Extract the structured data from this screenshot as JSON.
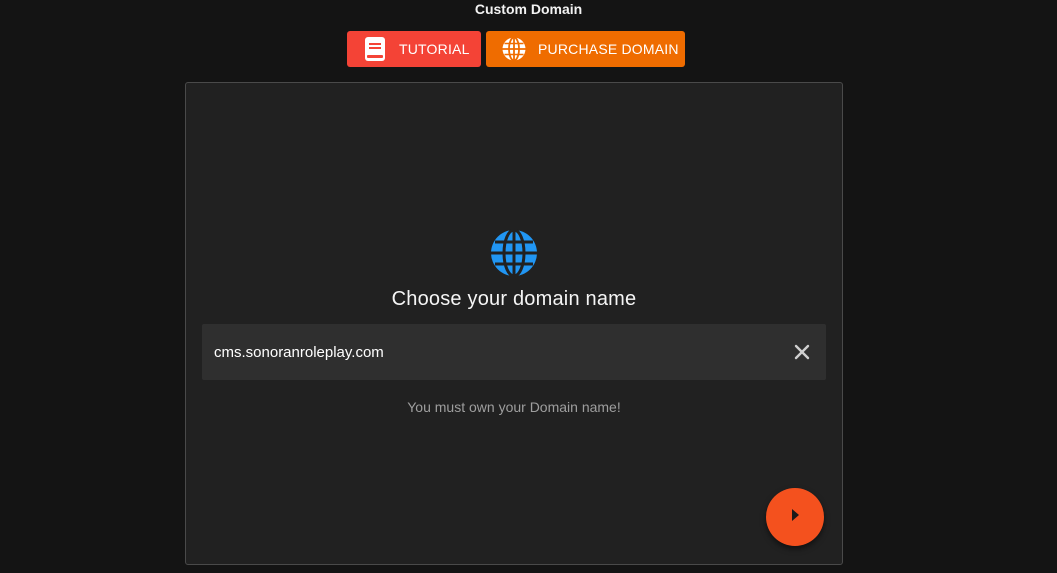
{
  "page": {
    "title": "Custom Domain"
  },
  "buttons": {
    "tutorial": {
      "label": "TUTORIAL",
      "icon": "book-icon",
      "color": "#f44336"
    },
    "purchase": {
      "label": "PURCHASE DOMAIN",
      "icon": "globe-icon",
      "color": "#ef6c00"
    }
  },
  "card": {
    "icon": "globe-icon",
    "icon_color": "#2196f3",
    "heading": "Choose your domain name",
    "domain_input": {
      "value": "cms.sonoranroleplay.com"
    },
    "hint": "You must own your Domain name!",
    "next_button": {
      "icon": "play-arrow-icon",
      "color": "#f4511e"
    }
  }
}
